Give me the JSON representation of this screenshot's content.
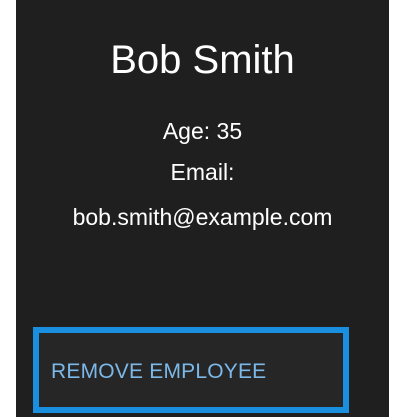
{
  "employee": {
    "name": "Bob Smith",
    "age_text": "Age: 35",
    "email_label": "Email:",
    "email_value": "bob.smith@example.com"
  },
  "actions": {
    "remove_label": "REMOVE EMPLOYEE"
  },
  "colors": {
    "card_background": "#1f1f1f",
    "focus_ring": "#1a8fe0",
    "button_text": "#7cb8e8"
  }
}
